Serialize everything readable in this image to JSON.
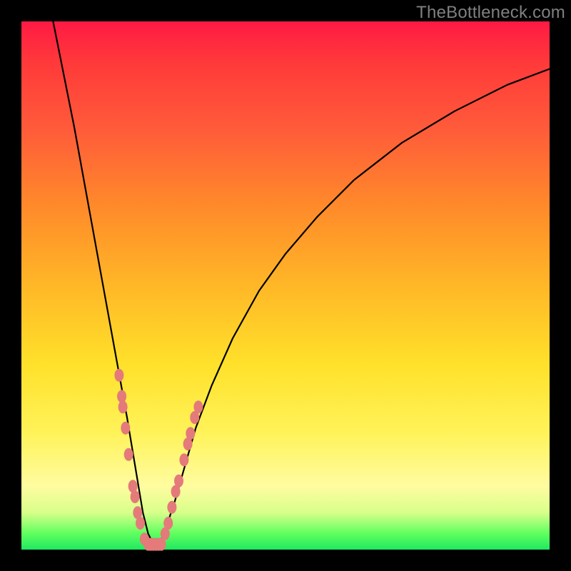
{
  "watermark": "TheBottleneck.com",
  "colors": {
    "dot": "#e47a7a",
    "curve": "#000000",
    "frame": "#000000"
  },
  "chart_data": {
    "type": "line",
    "title": "",
    "xlabel": "",
    "ylabel": "",
    "xlim": [
      0,
      100
    ],
    "ylim": [
      0,
      100
    ],
    "grid": false,
    "legend": false,
    "note": "V-shaped bottleneck curve on red→green vertical gradient. x is an implied component-ratio axis; y is an implied bottleneck-percentage axis. Values are read from the curve geometry (0 = bottom/green, 100 = top/red).",
    "series": [
      {
        "name": "bottleneck-curve",
        "x": [
          6,
          8,
          10,
          12,
          14,
          16,
          18,
          20,
          21,
          22,
          23,
          24,
          25,
          26,
          27,
          29,
          31,
          33,
          36,
          40,
          45,
          50,
          56,
          63,
          72,
          82,
          92,
          100
        ],
        "y": [
          100,
          90,
          80,
          69,
          58,
          47,
          36,
          25,
          19,
          13,
          7,
          3,
          1,
          1,
          3,
          9,
          16,
          23,
          31,
          40,
          49,
          56,
          63,
          70,
          77,
          83,
          88,
          91
        ]
      }
    ],
    "markers": {
      "name": "highlighted-points",
      "note": "Salmon dots clustered near the valley on both branches and along the floor.",
      "points": [
        {
          "x": 18.5,
          "y": 33
        },
        {
          "x": 19.0,
          "y": 29
        },
        {
          "x": 19.2,
          "y": 27
        },
        {
          "x": 19.7,
          "y": 23
        },
        {
          "x": 20.3,
          "y": 18
        },
        {
          "x": 21.1,
          "y": 12
        },
        {
          "x": 21.5,
          "y": 10
        },
        {
          "x": 22.0,
          "y": 7
        },
        {
          "x": 22.5,
          "y": 5
        },
        {
          "x": 23.3,
          "y": 2
        },
        {
          "x": 24.0,
          "y": 1
        },
        {
          "x": 24.5,
          "y": 1
        },
        {
          "x": 25.0,
          "y": 1
        },
        {
          "x": 25.5,
          "y": 1
        },
        {
          "x": 26.0,
          "y": 1
        },
        {
          "x": 26.5,
          "y": 1
        },
        {
          "x": 27.2,
          "y": 3
        },
        {
          "x": 27.8,
          "y": 5
        },
        {
          "x": 28.5,
          "y": 8
        },
        {
          "x": 29.2,
          "y": 11
        },
        {
          "x": 29.8,
          "y": 13
        },
        {
          "x": 30.8,
          "y": 17
        },
        {
          "x": 31.5,
          "y": 20
        },
        {
          "x": 32.0,
          "y": 22
        },
        {
          "x": 32.8,
          "y": 25
        },
        {
          "x": 33.5,
          "y": 27
        }
      ]
    }
  }
}
